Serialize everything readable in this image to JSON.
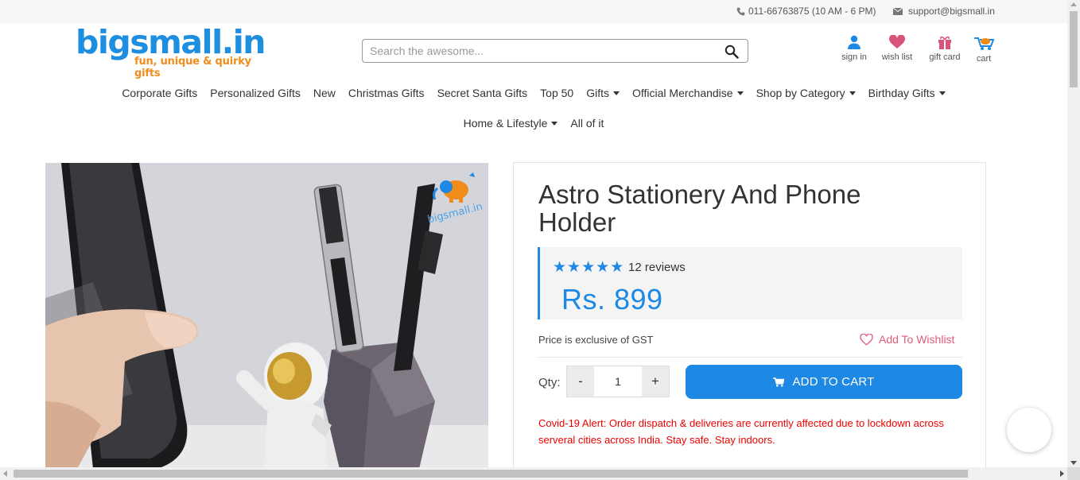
{
  "topbar": {
    "phone": "011-66763875 (10 AM - 6 PM)",
    "email": "support@bigsmall.in"
  },
  "logo": {
    "wordmark": "bigsmall.in",
    "tagline": "fun, unique & quirky gifts"
  },
  "search": {
    "placeholder": "Search the awesome...",
    "value": ""
  },
  "header_icons": {
    "signin": "sign in",
    "wishlist": "wish list",
    "giftcard": "gift card",
    "cart": "cart"
  },
  "nav": {
    "row1": [
      {
        "label": "Corporate Gifts",
        "dropdown": false
      },
      {
        "label": "Personalized Gifts",
        "dropdown": false
      },
      {
        "label": "New",
        "dropdown": false
      },
      {
        "label": "Christmas Gifts",
        "dropdown": false
      },
      {
        "label": "Secret Santa Gifts",
        "dropdown": false
      },
      {
        "label": "Top 50",
        "dropdown": false
      },
      {
        "label": "Gifts",
        "dropdown": true
      },
      {
        "label": "Official Merchandise",
        "dropdown": true
      },
      {
        "label": "Shop by Category",
        "dropdown": true
      },
      {
        "label": "Birthday Gifts",
        "dropdown": true
      }
    ],
    "row2": [
      {
        "label": "Home & Lifestyle",
        "dropdown": true
      },
      {
        "label": "All of it",
        "dropdown": false
      }
    ]
  },
  "product": {
    "title": "Astro Stationery And Phone Holder",
    "rating": 5,
    "reviews": "12 reviews",
    "price": "Rs. 899",
    "gst_note": "Price is exclusive of GST",
    "wishlist_label": "Add To Wishlist",
    "qty_label": "Qty:",
    "qty_minus": "-",
    "qty_value": "1",
    "qty_plus": "+",
    "add_to_cart": "ADD TO CART",
    "alert": "Covid-19 Alert: Order dispatch & deliveries are currently affected due to lockdown across serveral cities across India. Stay safe. Stay indoors.",
    "image_watermark": "bigsmall.in"
  },
  "colors": {
    "brand_blue": "#1e88e5",
    "logo_orange": "#f08c1a",
    "alert_red": "#ee0000",
    "wishlist_pink": "#e05b7a"
  }
}
